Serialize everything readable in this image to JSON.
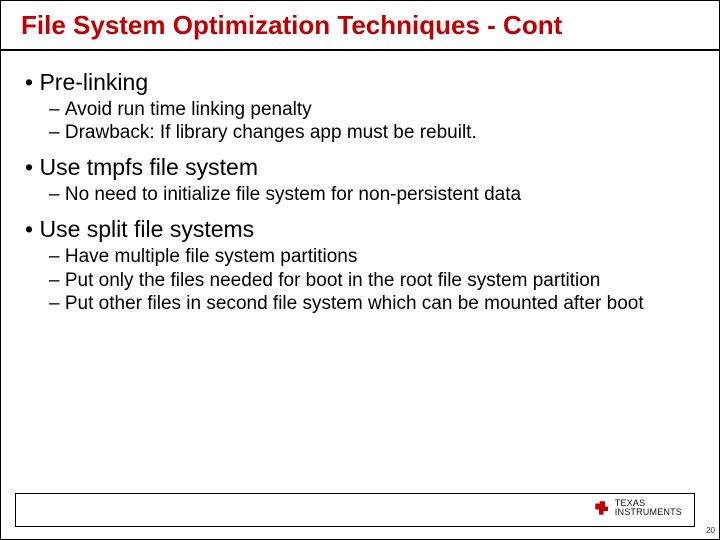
{
  "slide": {
    "title": "File System Optimization Techniques - Cont",
    "bullets": [
      {
        "label": "Pre-linking",
        "subs": [
          "Avoid run time linking penalty",
          "Drawback: If library changes app must be rebuilt."
        ]
      },
      {
        "label": "Use tmpfs file system",
        "subs": [
          "No need to initialize file system for non-persistent data"
        ]
      },
      {
        "label": "Use split file systems",
        "subs": [
          "Have multiple file system partitions",
          "Put only the files needed for boot in the root file system partition",
          "Put other files in second file system which can be mounted after boot"
        ]
      }
    ],
    "footer": {
      "logo_line1": "TEXAS",
      "logo_line2": "INSTRUMENTS",
      "page_number": "20"
    }
  }
}
